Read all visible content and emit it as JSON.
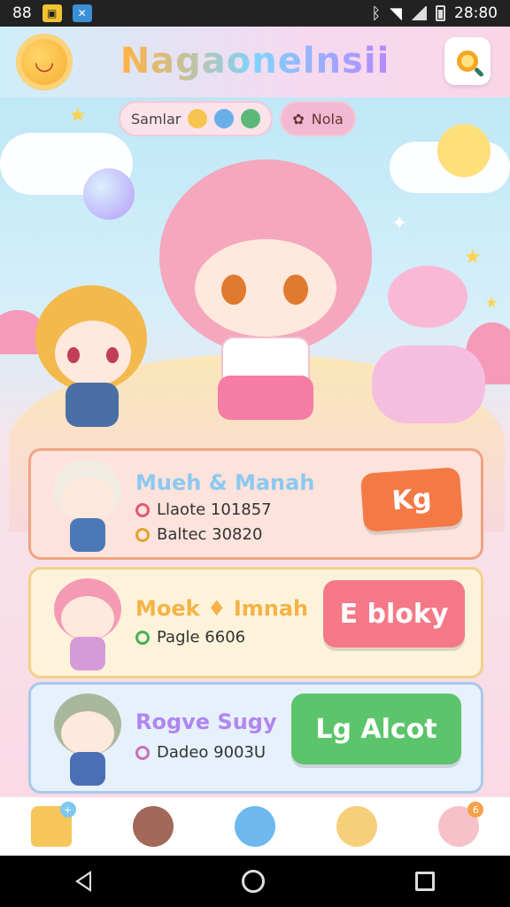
{
  "status_bar": {
    "left_text": "88",
    "time": "28:80",
    "icons": [
      "notification-yellow-icon",
      "notification-blue-icon",
      "bluetooth-icon",
      "wifi-icon",
      "signal-icon",
      "battery-icon"
    ]
  },
  "header": {
    "title": "Nagaonelnsii",
    "logo_icon": "sun-smiley-icon",
    "search_icon": "search-icon"
  },
  "top_pills": [
    {
      "label": "Samlar",
      "icons": [
        "yellow-face-icon",
        "blue-face-icon",
        "green-face-icon"
      ]
    },
    {
      "label": "Nola",
      "icons": [
        "ribbon-icon"
      ]
    }
  ],
  "cards": [
    {
      "title": "Mueh & Manah",
      "lines": [
        {
          "icon": "pin-icon",
          "text": "Llaote 101857"
        },
        {
          "icon": "coin-icon",
          "text": "Baltec 30820"
        }
      ],
      "cta_label": "Kg",
      "colors": {
        "bg": "#fde3dc",
        "border": "#f0a383",
        "title": "#8cc9f0",
        "cta": "#f47a45"
      }
    },
    {
      "title": "Moek ♦ Imnah",
      "lines": [
        {
          "icon": "leaf-icon",
          "text": "Pagle 6606"
        }
      ],
      "cta_label": "E bloky",
      "colors": {
        "bg": "#fdf3da",
        "border": "#f1d08a",
        "title": "#f4b347",
        "cta": "#f57887"
      }
    },
    {
      "title": "Rogve Sugy",
      "lines": [
        {
          "icon": "paw-icon",
          "text": "Dadeo 9003U"
        }
      ],
      "cta_label": "Lg Alcot",
      "colors": {
        "bg": "#e6f1fb",
        "border": "#a8c9ea",
        "title": "#b186f0",
        "cta": "#5cc46a"
      }
    }
  ],
  "bottom_nav": [
    {
      "icon": "house-icon",
      "color": "#f7c65b",
      "badge": "+"
    },
    {
      "icon": "bear-icon",
      "color": "#a2685a",
      "badge": ""
    },
    {
      "icon": "blue-creature-icon",
      "color": "#6cb8ef",
      "badge": ""
    },
    {
      "icon": "chick-icon",
      "color": "#f5cf7a",
      "badge": ""
    },
    {
      "icon": "bunny-icon",
      "color": "#f6c1c8",
      "badge": "6"
    }
  ],
  "system_nav": [
    "back-icon",
    "home-icon",
    "recents-icon"
  ]
}
